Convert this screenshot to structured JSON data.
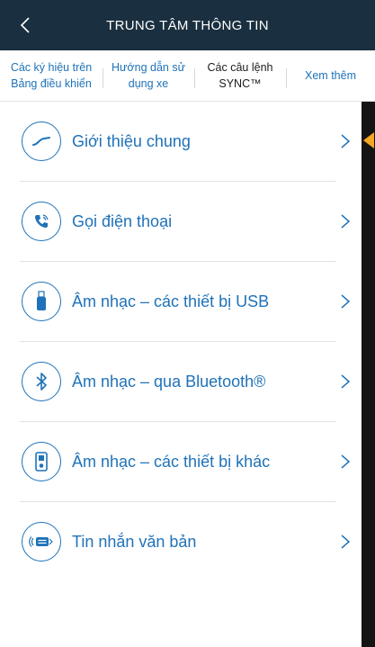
{
  "header": {
    "title": "TRUNG TÂM THÔNG TIN",
    "back_icon": "chevron-left-icon"
  },
  "tabs": [
    {
      "label": "Các ký hiệu trên\nBảng điều khiển",
      "active": false
    },
    {
      "label": "Hướng dẫn sử\ndụng xe",
      "active": false
    },
    {
      "label": "Các câu lệnh\nSYNC™",
      "active": true
    },
    {
      "label": "Xem thêm",
      "active": false
    }
  ],
  "items": [
    {
      "label": "Giới thiệu chung",
      "icon": "sync-swoosh-icon"
    },
    {
      "label": "Gọi điện thoại",
      "icon": "phone-icon"
    },
    {
      "label": "Âm nhạc – các thiết bị USB",
      "icon": "usb-icon"
    },
    {
      "label": "Âm nhạc – qua Bluetooth®",
      "icon": "bluetooth-icon"
    },
    {
      "label": "Âm nhạc – các thiết bị khác",
      "icon": "media-player-icon"
    },
    {
      "label": "Tin nhắn văn bản",
      "icon": "text-message-icon"
    }
  ],
  "colors": {
    "header_bg": "#1a2f3f",
    "accent": "#1f72b8",
    "scroll_marker": "#f5a623"
  }
}
